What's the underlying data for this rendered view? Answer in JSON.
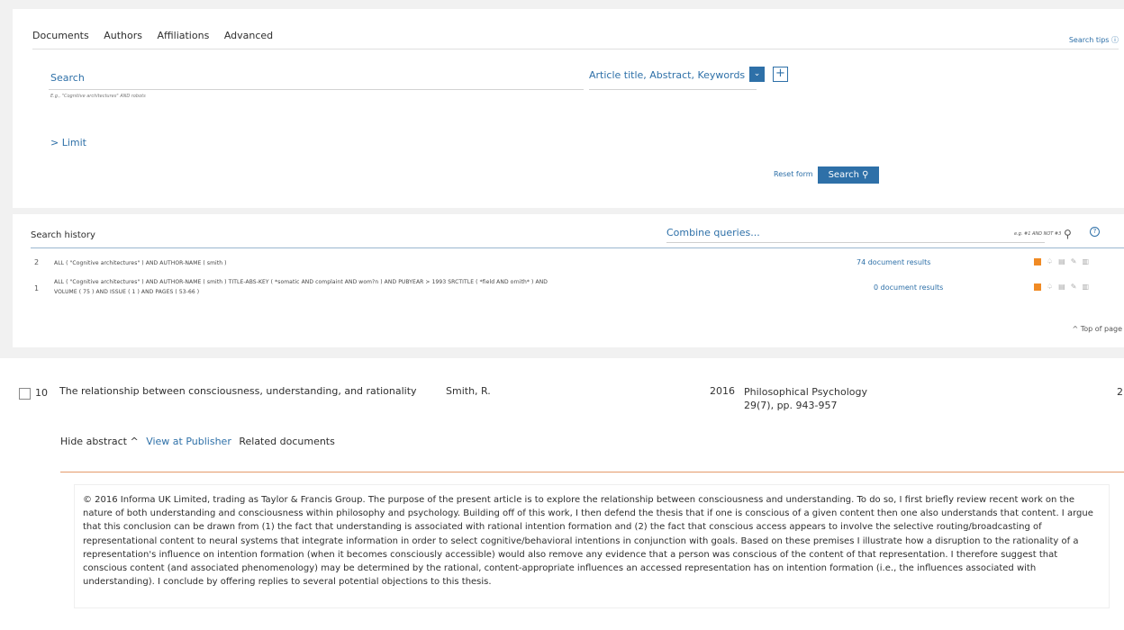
{
  "search_panel": {
    "tabs": [
      "Documents",
      "Authors",
      "Affiliations",
      "Advanced"
    ],
    "search_tips": "Search tips ⓘ",
    "search_label": "Search",
    "search_example": "E.g., \"Cognitive architectures\" AND robots",
    "field_select": "Article title, Abstract, Keywords",
    "chevron": "⌄",
    "plus": "+",
    "limit": "> Limit",
    "reset": "Reset form",
    "search_button": "Search ⚲"
  },
  "history": {
    "title": "Search history",
    "combine_placeholder": "Combine queries...",
    "example": "e.g. #1 AND NOT #3",
    "search_icon": "⚲",
    "help": "?",
    "rows": [
      {
        "n": "2",
        "query_line1": "ALL ( \"Cognitive architectures\" ) AND AUTHOR-NAME ( smith )",
        "query_line2": "",
        "count": "74 document results"
      },
      {
        "n": "1",
        "query_line1": "ALL ( \"Cognitive architectures\" ) AND AUTHOR-NAME ( smith ) TITLE-ABS-KEY ( *somatic AND complaint AND wom?n ) AND PUBYEAR > 1993 SRCTITLE ( *field AND ornith* ) AND",
        "query_line2": "VOLUME ( 75 ) AND ISSUE ( 1 ) AND PAGES ( 53-66 )",
        "count": "0 document results"
      }
    ],
    "row_icons": [
      "rss-icon",
      "bell-icon",
      "save-icon",
      "edit-icon",
      "delete-icon"
    ],
    "top_of_page": "^ Top of page"
  },
  "result": {
    "number": "10",
    "title": "The relationship between consciousness, understanding, and rationality",
    "author": "Smith, R.",
    "year": "2016",
    "source_line1": "Philosophical Psychology",
    "source_line2": "29(7), pp. 943-957",
    "cited": "2",
    "hide_abstract": "Hide abstract ^",
    "view_at_publisher": "View at Publisher",
    "related_documents": "Related documents",
    "abstract": "© 2016 Informa UK Limited, trading as Taylor & Francis Group. The purpose of the present article is to explore the relationship between consciousness and understanding. To do so, I first briefly review recent work on the nature of both understanding and consciousness within philosophy and psychology. Building off of this work, I then defend the thesis that if one is conscious of a given content then one also understands that content. I argue that this conclusion can be drawn from (1) the fact that understanding is associated with rational intention formation and (2) the fact that conscious access appears to involve the selective routing/broadcasting of representational content to neural systems that integrate information in order to select cognitive/behavioral intentions in conjunction with goals. Based on these premises I illustrate how a disruption to the rationality of a representation's influence on intention formation (when it becomes consciously accessible) would also remove any evidence that a person was conscious of the content of that representation. I therefore suggest that conscious content (and associated phenomenology) may be determined by the rational, content-appropriate influences an accessed representation has on intention formation (i.e., the influences associated with understanding). I conclude by offering replies to several potential objections to this thesis."
  },
  "colors": {
    "accent": "#2e70a8",
    "rss": "#f08a24",
    "divider": "#e59a6a"
  }
}
